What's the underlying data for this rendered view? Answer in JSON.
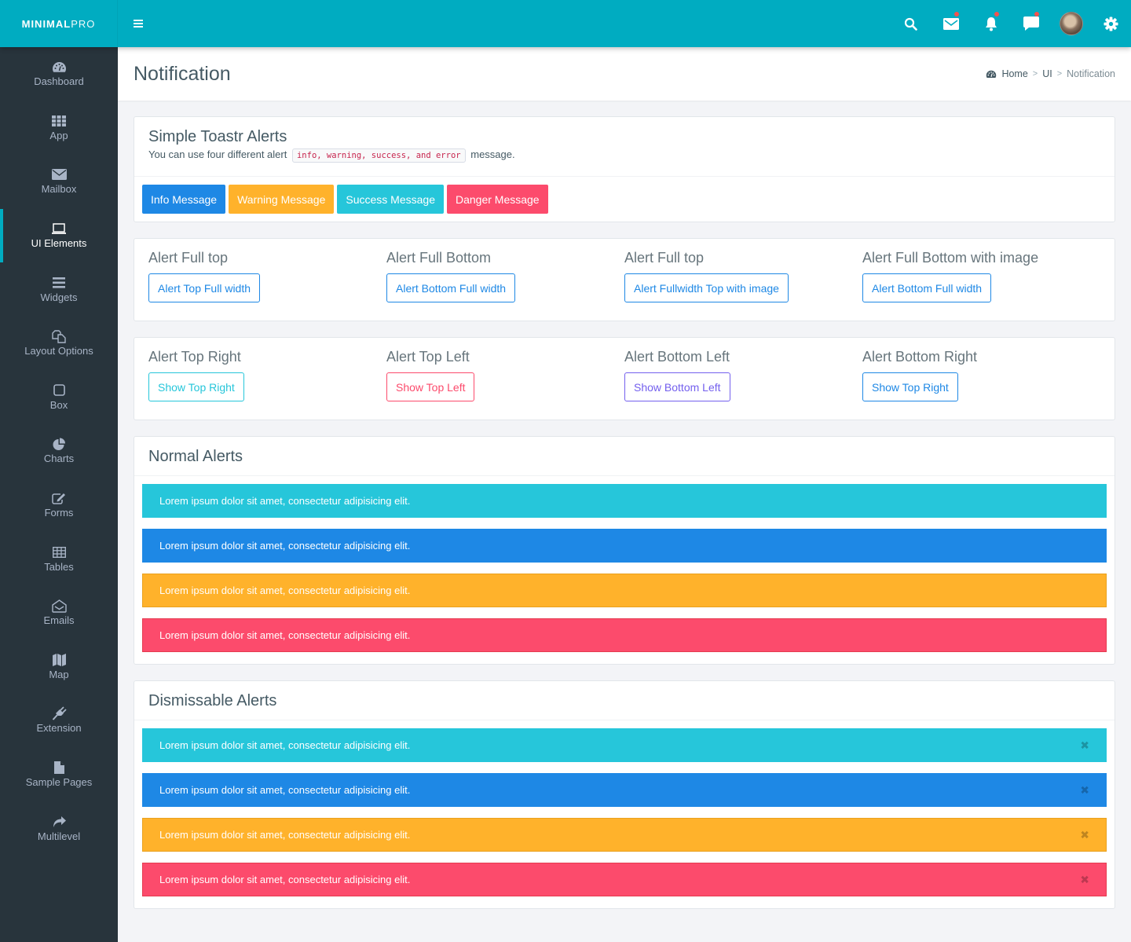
{
  "brand": {
    "bold": "MINIMAL",
    "light": "PRO"
  },
  "topbar": {
    "icons": [
      {
        "name": "search-icon",
        "badge": false
      },
      {
        "name": "mail-icon",
        "badge": true
      },
      {
        "name": "bell-icon",
        "badge": true
      },
      {
        "name": "chat-icon",
        "badge": true
      },
      {
        "name": "avatar",
        "badge": false
      },
      {
        "name": "gear-icon",
        "badge": false
      }
    ]
  },
  "sidebar": {
    "active": "UI Elements",
    "items": [
      {
        "label": "Dashboard",
        "icon": "dashboard-icon"
      },
      {
        "label": "App",
        "icon": "grid-icon"
      },
      {
        "label": "Mailbox",
        "icon": "envelope-icon"
      },
      {
        "label": "UI Elements",
        "icon": "laptop-icon"
      },
      {
        "label": "Widgets",
        "icon": "bars-icon"
      },
      {
        "label": "Layout Options",
        "icon": "copy-icon"
      },
      {
        "label": "Box",
        "icon": "square-icon"
      },
      {
        "label": "Charts",
        "icon": "pie-chart-icon"
      },
      {
        "label": "Forms",
        "icon": "edit-icon"
      },
      {
        "label": "Tables",
        "icon": "table-icon"
      },
      {
        "label": "Emails",
        "icon": "envelope-open-icon"
      },
      {
        "label": "Map",
        "icon": "map-icon"
      },
      {
        "label": "Extension",
        "icon": "plug-icon"
      },
      {
        "label": "Sample Pages",
        "icon": "file-icon"
      },
      {
        "label": "Multilevel",
        "icon": "share-icon"
      }
    ]
  },
  "page": {
    "title": "Notification",
    "breadcrumb": {
      "home": "Home",
      "section": "UI",
      "current": "Notification",
      "separator": ">"
    }
  },
  "toastr": {
    "title": "Simple Toastr Alerts",
    "desc_before": "You can use four different alert",
    "code": "info, warning, success, and error",
    "desc_after": "message.",
    "buttons": [
      {
        "label": "Info Message",
        "color": "#1e88e5"
      },
      {
        "label": "Warning Message",
        "color": "#ffb22b"
      },
      {
        "label": "Success Message",
        "color": "#26c6da"
      },
      {
        "label": "Danger Message",
        "color": "#fc4b6c"
      }
    ]
  },
  "full_positions": [
    {
      "heading": "Alert Full top",
      "button": "Alert Top Full width",
      "color": "#1e88e5"
    },
    {
      "heading": "Alert Full Bottom",
      "button": "Alert Bottom Full width",
      "color": "#1e88e5"
    },
    {
      "heading": "Alert Full top",
      "button": "Alert Fullwidth Top with image",
      "color": "#1e88e5"
    },
    {
      "heading": "Alert Full Bottom with image",
      "button": "Alert Bottom Full width",
      "color": "#1e88e5"
    }
  ],
  "corner_positions": [
    {
      "heading": "Alert Top Right",
      "button": "Show Top Right",
      "color": "#26c6da"
    },
    {
      "heading": "Alert Top Left",
      "button": "Show Top Left",
      "color": "#fc4b6c"
    },
    {
      "heading": "Alert Bottom Left",
      "button": "Show Bottom Left",
      "color": "#7460ee"
    },
    {
      "heading": "Alert Bottom Right",
      "button": "Show Top Right",
      "color": "#1e88e5"
    }
  ],
  "normal_alerts": {
    "title": "Normal Alerts",
    "items": [
      {
        "text": "Lorem ipsum dolor sit amet, consectetur adipisicing elit.",
        "type": "info",
        "color": "#26c6da"
      },
      {
        "text": "Lorem ipsum dolor sit amet, consectetur adipisicing elit.",
        "type": "primary",
        "color": "#1e88e5"
      },
      {
        "text": "Lorem ipsum dolor sit amet, consectetur adipisicing elit.",
        "type": "warning",
        "color": "#ffb22b"
      },
      {
        "text": "Lorem ipsum dolor sit amet, consectetur adipisicing elit.",
        "type": "danger",
        "color": "#fc4b6c"
      }
    ]
  },
  "dismissable_alerts": {
    "title": "Dismissable Alerts",
    "close_glyph": "✖",
    "items": [
      {
        "text": "Lorem ipsum dolor sit amet, consectetur adipisicing elit.",
        "type": "info",
        "color": "#26c6da"
      },
      {
        "text": "Lorem ipsum dolor sit amet, consectetur adipisicing elit.",
        "type": "primary",
        "color": "#1e88e5"
      },
      {
        "text": "Lorem ipsum dolor sit amet, consectetur adipisicing elit.",
        "type": "warning",
        "color": "#ffb22b"
      },
      {
        "text": "Lorem ipsum dolor sit amet, consectetur adipisicing elit.",
        "type": "danger",
        "color": "#fc4b6c"
      }
    ]
  }
}
